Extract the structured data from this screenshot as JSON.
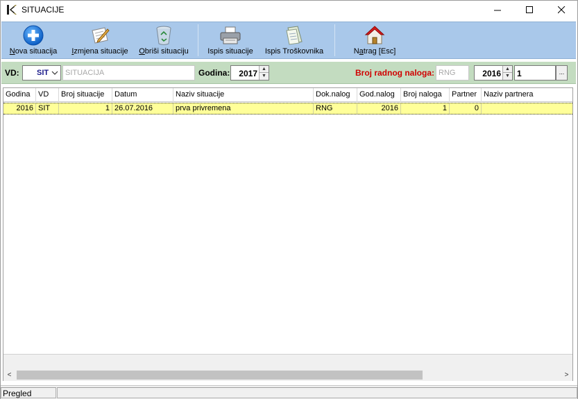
{
  "window": {
    "title": "SITUACIJE",
    "controls": {
      "minimize": "—",
      "maximize": "☐",
      "close": "✕"
    }
  },
  "toolbar": {
    "buttons": [
      {
        "label": "Nova situacija",
        "mnemonic": "N",
        "rest": "ova situacija",
        "icon": "plus-circle-icon"
      },
      {
        "label": "Izmjena situacije",
        "mnemonic": "I",
        "rest": "zmjena situacije",
        "icon": "edit-pencil-icon"
      },
      {
        "label": "Obriši situaciju",
        "mnemonic": "O",
        "rest": "briši situaciju",
        "icon": "recycle-bin-icon"
      },
      {
        "label": "Ispis situacije",
        "icon": "printer-icon"
      },
      {
        "label": "Ispis Troškovnika",
        "icon": "document-print-icon"
      },
      {
        "label": "Natrag [Esc]",
        "pre": "N",
        "mnemonic": "a",
        "rest": "trag [Esc]",
        "icon": "home-icon"
      }
    ]
  },
  "filter": {
    "vd_label": "VD:",
    "vd_value": "SIT",
    "vd_name": "SITUACIJA",
    "godina_label": "Godina:",
    "godina_value": "2017",
    "broj_radnog_naloga_label": "Broj radnog naloga:",
    "rng_value": "RNG",
    "rn_year": "2016",
    "rn_number": "1",
    "dots": "..."
  },
  "grid": {
    "columns": [
      "Godina",
      "VD",
      "Broj situacije",
      "Datum",
      "Naziv situacije",
      "Dok.nalog",
      "God.nalog",
      "Broj naloga",
      "Partner",
      "Naziv partnera"
    ],
    "rows": [
      [
        "2016",
        "SIT",
        "1",
        "26.07.2016",
        "prva privremena",
        "RNG",
        "2016",
        "1",
        "0",
        ""
      ]
    ]
  },
  "scrollbar": {
    "left": "<",
    "right": ">"
  },
  "status": {
    "mode": "Pregled"
  },
  "colors": {
    "toolbar": "#a9c8ea",
    "filterbar": "#c3dcc0",
    "selected_row": "#ffff99",
    "label_red": "#d00000"
  }
}
